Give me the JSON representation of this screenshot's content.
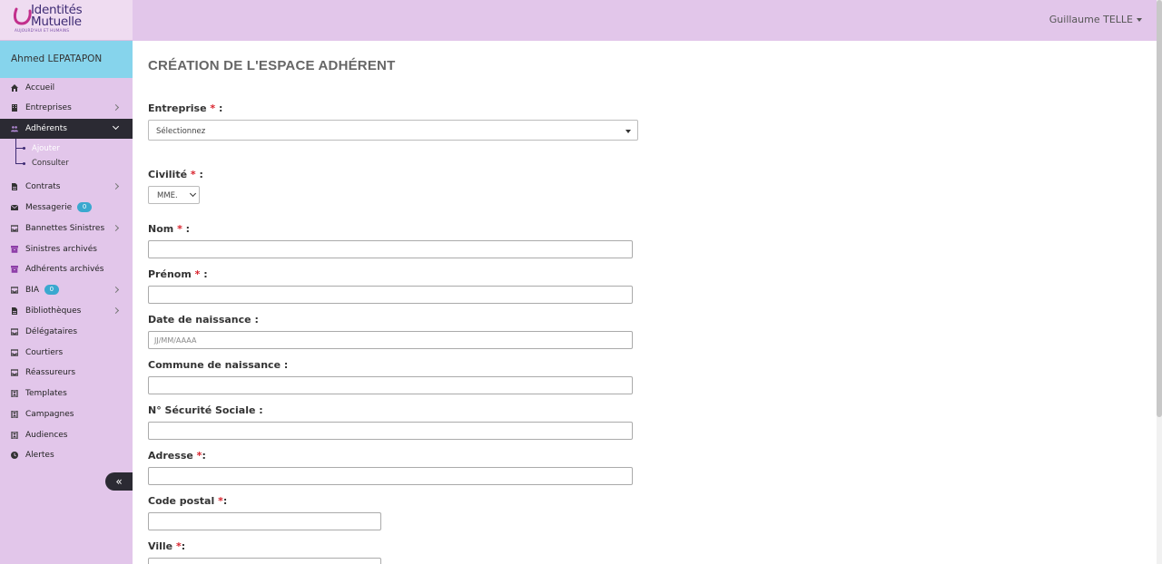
{
  "logo": {
    "line1": "Identités",
    "line2": "Mutuelle",
    "tagline": "AUJOURD'HUI ET HUMAINS"
  },
  "header": {
    "user_name": "Guillaume TELLE"
  },
  "sidebar": {
    "user": "Ahmed LEPATAPON",
    "items": [
      {
        "label": "Accueil",
        "icon": "home-icon"
      },
      {
        "label": "Entreprises",
        "icon": "building-icon"
      },
      {
        "label": "Adhérents",
        "icon": "users-icon"
      },
      {
        "label": "Contrats",
        "icon": "file-icon"
      },
      {
        "label": "Messagerie",
        "icon": "envelope-icon",
        "badge": "0"
      },
      {
        "label": "Bannettes Sinistres",
        "icon": "inbox-icon"
      },
      {
        "label": "Sinistres archivés",
        "icon": "archive-icon"
      },
      {
        "label": "Adhérents archivés",
        "icon": "archive-icon"
      },
      {
        "label": "BIA",
        "icon": "inbox-icon",
        "badge": "0"
      },
      {
        "label": "Bibliothèques",
        "icon": "file-icon"
      },
      {
        "label": "Délégataires",
        "icon": "inbox-icon"
      },
      {
        "label": "Courtiers",
        "icon": "inbox-icon"
      },
      {
        "label": "Réassureurs",
        "icon": "inbox-icon"
      },
      {
        "label": "Templates",
        "icon": "hourglass-icon"
      },
      {
        "label": "Campagnes",
        "icon": "hourglass-icon"
      },
      {
        "label": "Audiences",
        "icon": "hourglass-icon"
      },
      {
        "label": "Alertes",
        "icon": "clock-icon"
      }
    ],
    "sub_items": [
      {
        "label": "Ajouter"
      },
      {
        "label": "Consulter"
      }
    ],
    "collapse_glyph": "«"
  },
  "main": {
    "title": "CRÉATION DE L'ESPACE ADHÉRENT",
    "required_mark": "*",
    "fields": {
      "entreprise": {
        "label": "Entreprise",
        "suffix": " :",
        "value": "Sélectionnez"
      },
      "civilite": {
        "label": "Civilité",
        "suffix": " :",
        "value": "MME."
      },
      "nom": {
        "label": "Nom",
        "suffix": " :"
      },
      "prenom": {
        "label": "Prénom",
        "suffix": " :"
      },
      "date_naissance": {
        "label": "Date de naissance :",
        "placeholder": "JJ/MM/AAAA"
      },
      "commune": {
        "label": "Commune de naissance :"
      },
      "secu": {
        "label": "N° Sécurité Sociale :"
      },
      "adresse": {
        "label": "Adresse",
        "suffix": ":"
      },
      "code_postal": {
        "label": "Code postal",
        "suffix": ":"
      },
      "ville": {
        "label": "Ville",
        "suffix": ":"
      }
    }
  },
  "colors": {
    "sidebar_bg": "#e2c6ea",
    "active_bg": "#2b2a33",
    "user_band": "#86d4ec",
    "required": "#d9232d",
    "badge": "#3aa8cf"
  }
}
